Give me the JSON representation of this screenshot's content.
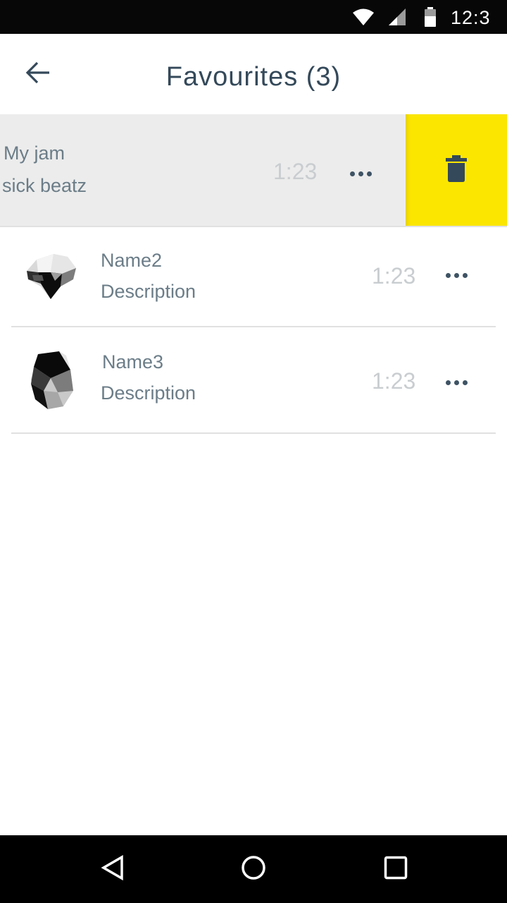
{
  "status_bar": {
    "time": "12:3",
    "icons": [
      "wifi-icon",
      "cellular-signal-icon",
      "battery-icon"
    ]
  },
  "header": {
    "title": "Favourites (3)",
    "back_icon": "arrow-left-icon"
  },
  "favourites": [
    {
      "name": "My jam",
      "description": "sick beatz",
      "duration": "1:23",
      "swiped_open": true,
      "action_icon": "more-horizontal-icon"
    },
    {
      "name": "Name2",
      "description": "Description",
      "duration": "1:23",
      "swiped_open": false,
      "action_icon": "more-horizontal-icon"
    },
    {
      "name": "Name3",
      "description": "Description",
      "duration": "1:23",
      "swiped_open": false,
      "action_icon": "more-horizontal-icon"
    }
  ],
  "delete_action": {
    "icon": "trash-icon",
    "color": "#fbe600"
  },
  "nav_bar": {
    "icons": [
      "back-triangle-icon",
      "home-circle-icon",
      "recents-square-icon"
    ]
  },
  "colors": {
    "accent_yellow": "#fbe600",
    "title_text": "#34495a",
    "body_text": "#6b7d88",
    "duration_text": "#c9cdd0",
    "swiped_row_bg": "#ececec"
  }
}
